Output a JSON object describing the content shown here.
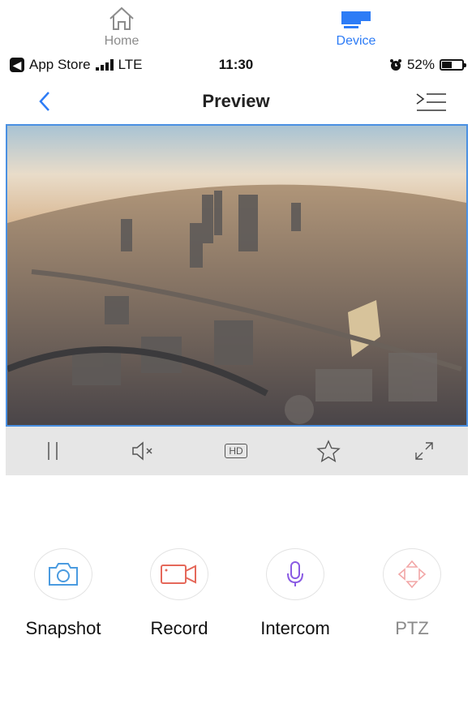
{
  "tabs": {
    "home_label": "Home",
    "device_label": "Device",
    "home_icon": "home-icon",
    "device_icon": "device-icon"
  },
  "status_bar": {
    "carrier": "App Store",
    "network": "LTE",
    "time": "11:30",
    "battery": "52%",
    "battery_level": 0.52
  },
  "nav": {
    "title": "Preview"
  },
  "video_controls": [
    "pause-icon",
    "mute-icon",
    "hd-icon",
    "favorite-star-icon",
    "fullscreen-icon"
  ],
  "hd_label": "HD",
  "actions": {
    "snapshot": "Snapshot",
    "record": "Record",
    "intercom": "Intercom",
    "ptz": "PTZ"
  },
  "colors": {
    "accent": "#2d7cf6",
    "snapshot": "#4a9be0",
    "record": "#e5685a",
    "intercom": "#8a5be3",
    "ptz": "#f2a7a7"
  }
}
